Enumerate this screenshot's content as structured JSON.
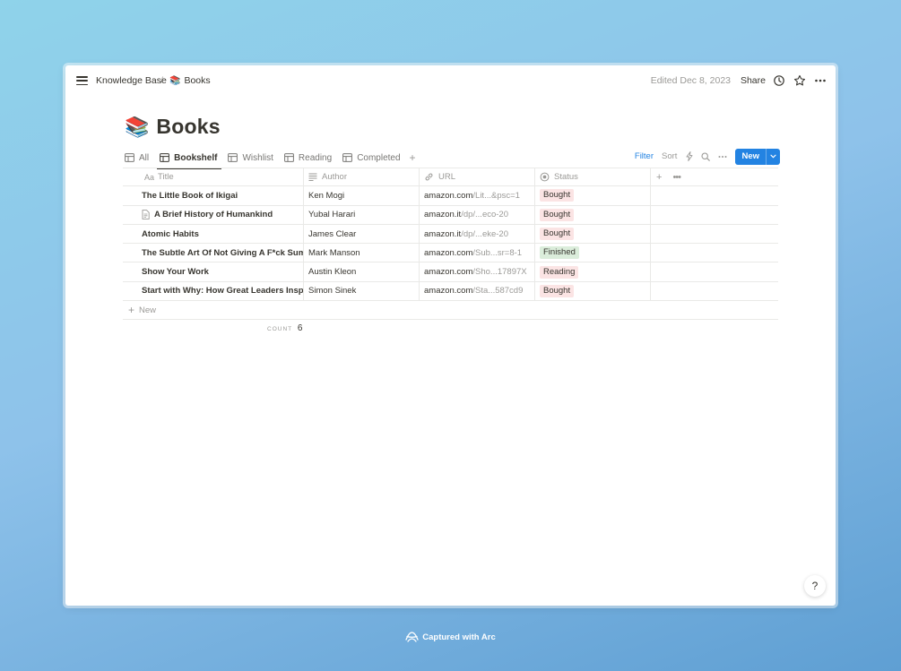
{
  "breadcrumb": {
    "parent": "Knowledge Base",
    "separator": "/",
    "page_emoji": "📚",
    "page": "Books"
  },
  "topbar": {
    "edited": "Edited Dec 8, 2023",
    "share": "Share"
  },
  "page": {
    "emoji": "📚",
    "title": "Books"
  },
  "views": [
    {
      "label": "All",
      "active": false
    },
    {
      "label": "Bookshelf",
      "active": true
    },
    {
      "label": "Wishlist",
      "active": false
    },
    {
      "label": "Reading",
      "active": false
    },
    {
      "label": "Completed",
      "active": false
    }
  ],
  "tools": {
    "filter": "Filter",
    "sort": "Sort",
    "new": "New"
  },
  "columns": {
    "title": "Title",
    "author": "Author",
    "url": "URL",
    "status": "Status"
  },
  "rows": [
    {
      "title": "The Little Book of Ikigai",
      "author": "Ken Mogi",
      "url_domain": "amazon.com",
      "url_path": "/Lit...&psc=1",
      "status": "Bought",
      "has_icon": false
    },
    {
      "title": "A Brief History of Humankind",
      "author": "Yubal Harari",
      "url_domain": "amazon.it",
      "url_path": "/dp/...eco-20",
      "status": "Bought",
      "has_icon": true
    },
    {
      "title": "Atomic Habits",
      "author": "James Clear",
      "url_domain": "amazon.it",
      "url_path": "/dp/...eke-20",
      "status": "Bought",
      "has_icon": false
    },
    {
      "title": "The Subtle Art Of Not Giving A F*ck Summ",
      "author": "Mark Manson",
      "url_domain": "amazon.com",
      "url_path": "/Sub...sr=8-1",
      "status": "Finished",
      "has_icon": false
    },
    {
      "title": "Show Your Work",
      "author": "Austin Kleon",
      "url_domain": "amazon.com",
      "url_path": "/Sho...17897X",
      "status": "Reading",
      "has_icon": false
    },
    {
      "title": "Start with Why: How Great Leaders Inspire",
      "author": "Simon Sinek",
      "url_domain": "amazon.com",
      "url_path": "/Sta...587cd9",
      "status": "Bought",
      "has_icon": false
    }
  ],
  "status_colors": {
    "Bought": "#fbe4e4",
    "Finished": "#dbeddb",
    "Reading": "#fbe4e4"
  },
  "new_row": "New",
  "count": {
    "label": "COUNT",
    "value": "6"
  },
  "help": "?",
  "footer": "Captured with Arc",
  "colors": {
    "accent": "#2383e2",
    "text": "#37352f",
    "muted": "#9b9a97"
  }
}
